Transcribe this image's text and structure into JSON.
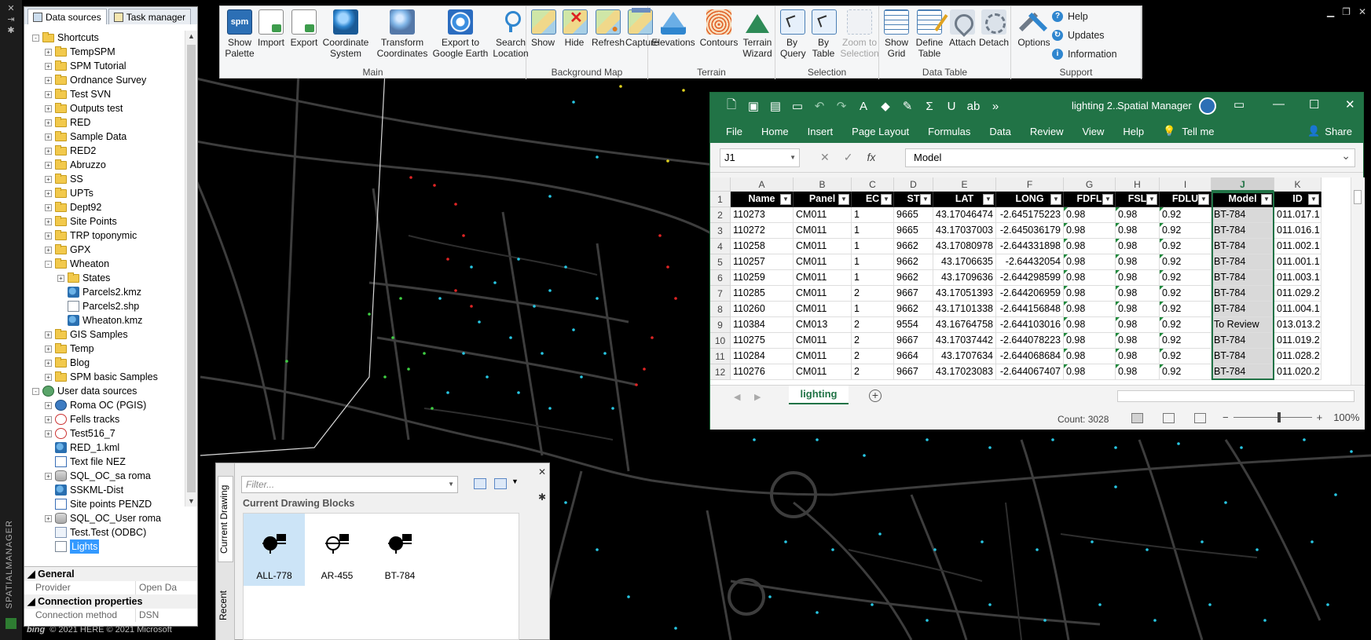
{
  "palette": {
    "tabs": [
      {
        "label": "Data sources",
        "active": true
      },
      {
        "label": "Task manager",
        "active": false
      }
    ],
    "vertical_title": "SPATIALMANAGER",
    "tree": [
      {
        "label": "Shortcuts",
        "icon": "folder",
        "level": 0,
        "exp": "-"
      },
      {
        "label": "TempSPM",
        "icon": "folder",
        "level": 1,
        "exp": "+"
      },
      {
        "label": "SPM Tutorial",
        "icon": "folder",
        "level": 1,
        "exp": "+"
      },
      {
        "label": "Ordnance Survey",
        "icon": "folder",
        "level": 1,
        "exp": "+"
      },
      {
        "label": "Test SVN",
        "icon": "folder",
        "level": 1,
        "exp": "+"
      },
      {
        "label": "Outputs test",
        "icon": "folder",
        "level": 1,
        "exp": "+"
      },
      {
        "label": "RED",
        "icon": "folder",
        "level": 1,
        "exp": "+"
      },
      {
        "label": "Sample Data",
        "icon": "folder",
        "level": 1,
        "exp": "+"
      },
      {
        "label": "RED2",
        "icon": "folder",
        "level": 1,
        "exp": "+"
      },
      {
        "label": "Abruzzo",
        "icon": "folder",
        "level": 1,
        "exp": "+"
      },
      {
        "label": "SS",
        "icon": "folder",
        "level": 1,
        "exp": "+"
      },
      {
        "label": "UPTs",
        "icon": "folder",
        "level": 1,
        "exp": "+"
      },
      {
        "label": "Dept92",
        "icon": "folder",
        "level": 1,
        "exp": "+"
      },
      {
        "label": "Site Points",
        "icon": "folder",
        "level": 1,
        "exp": "+"
      },
      {
        "label": "TRP toponymic",
        "icon": "folder",
        "level": 1,
        "exp": "+"
      },
      {
        "label": "GPX",
        "icon": "folder",
        "level": 1,
        "exp": "+"
      },
      {
        "label": "Wheaton",
        "icon": "folder",
        "level": 1,
        "exp": "-"
      },
      {
        "label": "States",
        "icon": "folder",
        "level": 2,
        "exp": "+"
      },
      {
        "label": "Parcels2.kmz",
        "icon": "kml",
        "level": 2,
        "exp": ""
      },
      {
        "label": "Parcels2.shp",
        "icon": "file",
        "level": 2,
        "exp": ""
      },
      {
        "label": "Wheaton.kmz",
        "icon": "kml",
        "level": 2,
        "exp": ""
      },
      {
        "label": "GIS Samples",
        "icon": "folder",
        "level": 1,
        "exp": "+"
      },
      {
        "label": "Temp",
        "icon": "folder",
        "level": 1,
        "exp": "+"
      },
      {
        "label": "Blog",
        "icon": "folder",
        "level": 1,
        "exp": "+"
      },
      {
        "label": "SPM basic Samples",
        "icon": "folder",
        "level": 1,
        "exp": "+"
      },
      {
        "label": "User data sources",
        "icon": "uds",
        "level": 0,
        "exp": "-"
      },
      {
        "label": "Roma OC (PGIS)",
        "icon": "pg",
        "level": 1,
        "exp": "+"
      },
      {
        "label": "Fells tracks",
        "icon": "gpx",
        "level": 1,
        "exp": "+"
      },
      {
        "label": "Test516_7",
        "icon": "gpx",
        "level": 1,
        "exp": "+"
      },
      {
        "label": "RED_1.kml",
        "icon": "kml",
        "level": 1,
        "exp": ""
      },
      {
        "label": "Text file NEZ",
        "icon": "xyz",
        "level": 1,
        "exp": ""
      },
      {
        "label": "SQL_OC_sa roma",
        "icon": "db",
        "level": 1,
        "exp": "+"
      },
      {
        "label": "SSKML-Dist",
        "icon": "kml",
        "level": 1,
        "exp": ""
      },
      {
        "label": "Site points PENZD",
        "icon": "xyz",
        "level": 1,
        "exp": ""
      },
      {
        "label": "SQL_OC_User roma",
        "icon": "db",
        "level": 1,
        "exp": "+"
      },
      {
        "label": "Test.Test (ODBC)",
        "icon": "odbc",
        "level": 1,
        "exp": ""
      },
      {
        "label": "Lights",
        "icon": "lights",
        "level": 1,
        "exp": "",
        "selected": true
      }
    ],
    "props": {
      "general_label": "General",
      "provider_key": "Provider",
      "provider_val": "Open Da",
      "connection_label": "Connection properties",
      "method_key": "Connection method",
      "method_val": "DSN"
    }
  },
  "ribbon": {
    "groups": [
      {
        "label": "Main",
        "buttons": [
          {
            "label": "Show\nPalette",
            "icon": "spm-icon"
          },
          {
            "label": "Import",
            "icon": "import-icon"
          },
          {
            "label": "Export",
            "icon": "export-icon"
          },
          {
            "label": "Coordinate\nSystem",
            "icon": "globe-icon"
          },
          {
            "label": "Transform\nCoordinates",
            "icon": "transform-globe-icon"
          },
          {
            "label": "Export to\nGoogle Earth",
            "icon": "google-earth-icon"
          },
          {
            "label": "Search\nLocation",
            "icon": "location-pin-icon"
          }
        ]
      },
      {
        "label": "Background Map",
        "buttons": [
          {
            "label": "Show",
            "icon": "map-show-icon"
          },
          {
            "label": "Hide",
            "icon": "map-hide-icon"
          },
          {
            "label": "Refresh",
            "icon": "map-refresh-icon"
          },
          {
            "label": "Capture",
            "icon": "map-capture-icon"
          }
        ]
      },
      {
        "label": "Terrain",
        "buttons": [
          {
            "label": "Elevations",
            "icon": "elevations-icon"
          },
          {
            "label": "Contours",
            "icon": "contours-icon"
          },
          {
            "label": "Terrain\nWizard",
            "icon": "terrain-wizard-icon"
          }
        ]
      },
      {
        "label": "Selection",
        "buttons": [
          {
            "label": "By\nQuery",
            "icon": "select-query-icon"
          },
          {
            "label": "By\nTable",
            "icon": "select-table-icon"
          },
          {
            "label": "Zoom to\nSelection",
            "icon": "zoom-selection-icon",
            "disabled": true
          }
        ]
      },
      {
        "label": "Data Table",
        "buttons": [
          {
            "label": "Show\nGrid",
            "icon": "grid-icon"
          },
          {
            "label": "Define\nTable",
            "icon": "define-table-icon"
          },
          {
            "label": "Attach",
            "icon": "attach-icon"
          },
          {
            "label": "Detach",
            "icon": "detach-icon"
          }
        ]
      },
      {
        "label": "Support",
        "buttons": [
          {
            "label": "Options",
            "icon": "options-icon"
          }
        ],
        "links": [
          "Help",
          "Updates",
          "Information"
        ]
      }
    ]
  },
  "excel": {
    "doc_title": "lighting 2...",
    "app_title": "Spatial Manager",
    "menu": [
      "File",
      "Home",
      "Insert",
      "Page Layout",
      "Formulas",
      "Data",
      "Review",
      "View",
      "Help"
    ],
    "tell_me": "Tell me",
    "share": "Share",
    "name_box": "J1",
    "formula": "Model",
    "columns": [
      "A",
      "B",
      "C",
      "D",
      "E",
      "F",
      "G",
      "H",
      "I",
      "J",
      "K"
    ],
    "selected_column": "J",
    "headers": [
      "Name",
      "Panel",
      "EC",
      "ST",
      "LAT",
      "LONG",
      "FDFL",
      "FSL",
      "FDLU",
      "Model",
      "ID"
    ],
    "rows": [
      [
        "110273",
        "CM011",
        "1",
        "9665",
        "43.17046474",
        "-2.645175223",
        "0.98",
        "0.98",
        "0.92",
        "BT-784",
        "011.017.1"
      ],
      [
        "110272",
        "CM011",
        "1",
        "9665",
        "43.17037003",
        "-2.645036179",
        "0.98",
        "0.98",
        "0.92",
        "BT-784",
        "011.016.1"
      ],
      [
        "110258",
        "CM011",
        "1",
        "9662",
        "43.17080978",
        "-2.644331898",
        "0.98",
        "0.98",
        "0.92",
        "BT-784",
        "011.002.1"
      ],
      [
        "110257",
        "CM011",
        "1",
        "9662",
        "43.1706635",
        "-2.64432054",
        "0.98",
        "0.98",
        "0.92",
        "BT-784",
        "011.001.1"
      ],
      [
        "110259",
        "CM011",
        "1",
        "9662",
        "43.1709636",
        "-2.644298599",
        "0.98",
        "0.98",
        "0.92",
        "BT-784",
        "011.003.1"
      ],
      [
        "110285",
        "CM011",
        "2",
        "9667",
        "43.17051393",
        "-2.644206959",
        "0.98",
        "0.98",
        "0.92",
        "BT-784",
        "011.029.2"
      ],
      [
        "110260",
        "CM011",
        "1",
        "9662",
        "43.17101338",
        "-2.644156848",
        "0.98",
        "0.98",
        "0.92",
        "BT-784",
        "011.004.1"
      ],
      [
        "110384",
        "CM013",
        "2",
        "9554",
        "43.16764758",
        "-2.644103016",
        "0.98",
        "0.98",
        "0.92",
        "To Review",
        "013.013.2"
      ],
      [
        "110275",
        "CM011",
        "2",
        "9667",
        "43.17037442",
        "-2.644078223",
        "0.98",
        "0.98",
        "0.92",
        "BT-784",
        "011.019.2"
      ],
      [
        "110284",
        "CM011",
        "2",
        "9664",
        "43.1707634",
        "-2.644068684",
        "0.98",
        "0.98",
        "0.92",
        "BT-784",
        "011.028.2"
      ],
      [
        "110276",
        "CM011",
        "2",
        "9667",
        "43.17023083",
        "-2.644067407",
        "0.98",
        "0.98",
        "0.92",
        "BT-784",
        "011.020.2"
      ]
    ],
    "sheet_name": "lighting",
    "count": "Count: 3028",
    "zoom": "100%"
  },
  "blocks": {
    "vtabs": [
      "Current Drawing",
      "Recent"
    ],
    "filter_placeholder": "Filter...",
    "heading": "Current Drawing Blocks",
    "items": [
      {
        "label": "ALL-778",
        "selected": true
      },
      {
        "label": "AR-455",
        "selected": false
      },
      {
        "label": "BT-784",
        "selected": false
      }
    ]
  },
  "map_credit": {
    "brand": "bing",
    "text": "© 2021 HERE © 2021 Microsoft"
  }
}
